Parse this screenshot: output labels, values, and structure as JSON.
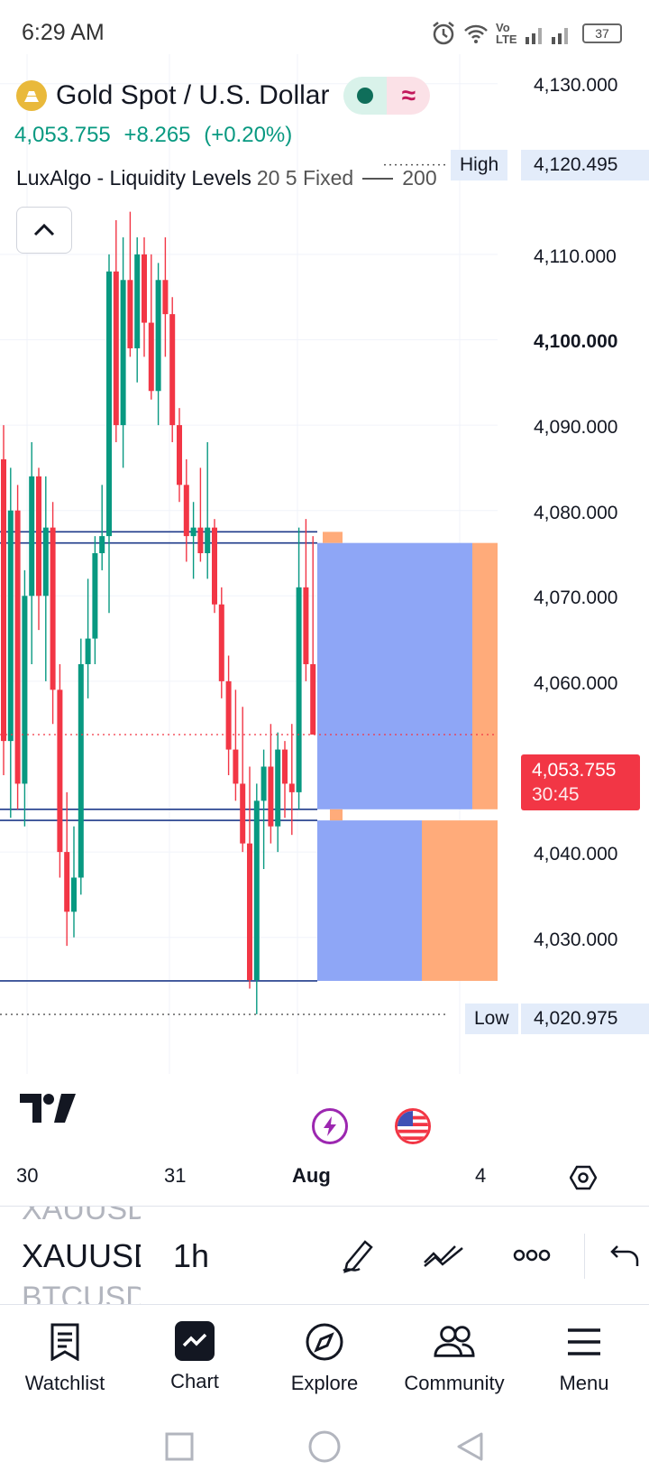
{
  "status_bar": {
    "time": "6:29 AM",
    "network": "Vo LTE",
    "battery": "37"
  },
  "header": {
    "title": "Gold Spot / U.S. Dollar",
    "price": "4,053.755",
    "change": "+8.265",
    "change_pct": "(+0.20%)",
    "indicator_name": "LuxAlgo - Liquidity Levels",
    "indicator_params": "20 5 Fixed",
    "indicator_value": "200"
  },
  "price_axis": {
    "labels": [
      "4,130.000",
      "4,110.000",
      "4,100.000",
      "4,090.000",
      "4,080.000",
      "4,070.000",
      "4,060.000",
      "4,040.000",
      "4,030.000"
    ],
    "high_tag": "High",
    "high_value": "4,120.495",
    "low_tag": "Low",
    "low_value": "4,020.975",
    "last_price": "4,053.755",
    "countdown": "30:45"
  },
  "time_axis": {
    "labels": [
      "30",
      "31",
      "Aug",
      "4"
    ]
  },
  "chart_data": {
    "type": "candlestick",
    "symbol": "XAUUSD",
    "interval": "1h",
    "ylim": [
      4020,
      4132
    ],
    "x_ticks": [
      "30",
      "31",
      "Aug",
      "4"
    ],
    "candles": [
      [
        4086,
        4090,
        4049,
        4053
      ],
      [
        4053,
        4085,
        4044,
        4080
      ],
      [
        4080,
        4083,
        4045,
        4048
      ],
      [
        4048,
        4073,
        4043,
        4070
      ],
      [
        4070,
        4088,
        4062,
        4084
      ],
      [
        4084,
        4085,
        4066,
        4070
      ],
      [
        4070,
        4084,
        4060,
        4078
      ],
      [
        4078,
        4081,
        4055,
        4059
      ],
      [
        4059,
        4062,
        4037,
        4040
      ],
      [
        4040,
        4047,
        4029,
        4033
      ],
      [
        4033,
        4043,
        4030,
        4037
      ],
      [
        4037,
        4065,
        4035,
        4062
      ],
      [
        4062,
        4072,
        4058,
        4065
      ],
      [
        4065,
        4077,
        4062,
        4075
      ],
      [
        4075,
        4083,
        4073,
        4077
      ],
      [
        4077,
        4110,
        4068,
        4108
      ],
      [
        4108,
        4114,
        4088,
        4090
      ],
      [
        4090,
        4112,
        4085,
        4107
      ],
      [
        4107,
        4115,
        4098,
        4099
      ],
      [
        4099,
        4112,
        4095,
        4110
      ],
      [
        4110,
        4112,
        4098,
        4102
      ],
      [
        4102,
        4110,
        4093,
        4094
      ],
      [
        4094,
        4109,
        4090,
        4107
      ],
      [
        4107,
        4112,
        4098,
        4103
      ],
      [
        4103,
        4105,
        4088,
        4090
      ],
      [
        4090,
        4092,
        4081,
        4083
      ],
      [
        4083,
        4086,
        4074,
        4077
      ],
      [
        4077,
        4081,
        4072,
        4078
      ],
      [
        4078,
        4085,
        4074,
        4075
      ],
      [
        4075,
        4088,
        4072,
        4078
      ],
      [
        4078,
        4079,
        4068,
        4069
      ],
      [
        4069,
        4071,
        4058,
        4060
      ],
      [
        4060,
        4063,
        4049,
        4052
      ],
      [
        4052,
        4059,
        4046,
        4048
      ],
      [
        4048,
        4057,
        4040,
        4041
      ],
      [
        4041,
        4050,
        4024,
        4025
      ],
      [
        4025,
        4048,
        4021,
        4046
      ],
      [
        4046,
        4052,
        4038,
        4050
      ],
      [
        4050,
        4055,
        4041,
        4043
      ],
      [
        4043,
        4054,
        4040,
        4052
      ],
      [
        4052,
        4053,
        4044,
        4048
      ],
      [
        4048,
        4055,
        4042,
        4047
      ],
      [
        4047,
        4078,
        4045,
        4071
      ],
      [
        4071,
        4079,
        4060,
        4062
      ],
      [
        4062,
        4077,
        4055,
        4053.755
      ]
    ],
    "liquidity_levels": [
      4077.5,
      4076.2,
      4045.0,
      4043.7,
      4024.9
    ],
    "zones": [
      {
        "from": 4045.0,
        "to": 4076.2,
        "blue_share": 0.86
      },
      {
        "from": 4024.9,
        "to": 4043.7,
        "blue_share": 0.58
      }
    ],
    "high": 4120.495,
    "low": 4020.975,
    "last": 4053.755
  },
  "toolbar": {
    "symbol_prev": "XAUUSD",
    "symbol": "XAUUSD",
    "symbol_next": "BTCUSD",
    "interval": "1h"
  },
  "nav": {
    "watchlist": "Watchlist",
    "chart": "Chart",
    "explore": "Explore",
    "community": "Community",
    "menu": "Menu"
  },
  "colors": {
    "up": "#089981",
    "down": "#f23645",
    "level_line": "#1e3a8a",
    "zone_blue": "#8ea6f6",
    "zone_orange": "#ffab7a",
    "label_bg": "#e3ecfa"
  },
  "icons": [
    "alarm-icon",
    "wifi-icon",
    "signal-icon",
    "battery-icon",
    "gold-logo-icon",
    "market-open-icon",
    "chevron-up-icon",
    "tradingview-logo-icon",
    "flash-event-icon",
    "us-flag-icon",
    "settings-icon",
    "pencil-icon",
    "trend-line-icon",
    "more-icon",
    "undo-icon",
    "watchlist-icon",
    "chart-icon",
    "compass-icon",
    "community-icon",
    "menu-icon",
    "square-nav-icon",
    "circle-nav-icon",
    "back-nav-icon"
  ]
}
